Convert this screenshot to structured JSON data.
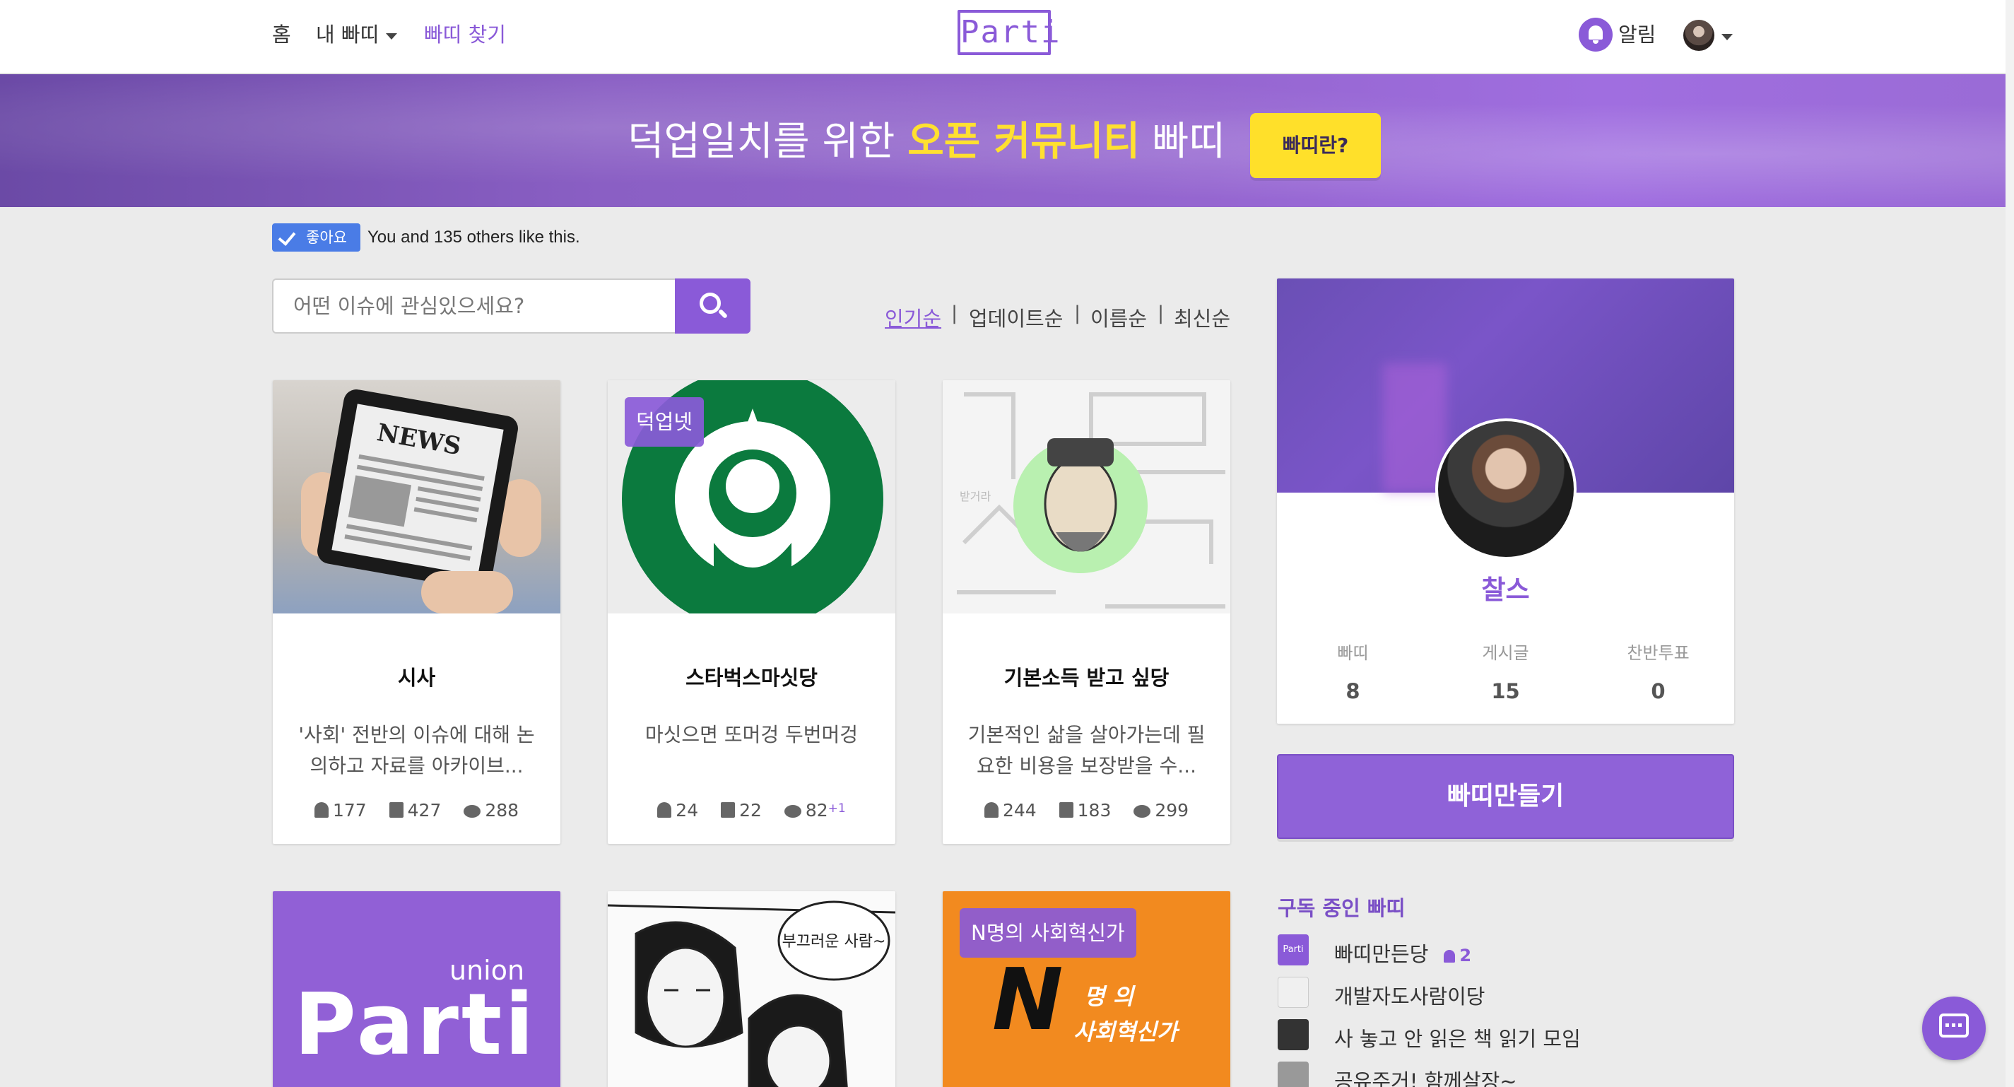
{
  "nav": {
    "home": "홈",
    "my_parti": "내 빠띠",
    "find_parti": "빠띠 찾기",
    "logo": "Parti",
    "alarm": "알림"
  },
  "banner": {
    "text_prefix": "덕업일치를 위한 ",
    "text_highlight": "오픈 커뮤니티",
    "text_suffix": " 빠띠",
    "button": "빠띠란?"
  },
  "like": {
    "button": "좋아요",
    "text": "You and 135 others like this."
  },
  "search": {
    "placeholder": "어떤 이슈에 관심있으세요?"
  },
  "sort": {
    "items": [
      "인기순",
      "업데이트순",
      "이름순",
      "최신순"
    ],
    "active": "인기순"
  },
  "cards": [
    {
      "title": "시사",
      "desc": "'사회' 전반의 이슈에 대해 논의하고 자료를 아카이브...",
      "members": "177",
      "posts": "427",
      "comments": "288",
      "image_text": "NEWS"
    },
    {
      "tag": "덕업넷",
      "title": "스타벅스마싯당",
      "desc": "마싯으면 또머겅 두번머겅",
      "members": "24",
      "posts": "22",
      "comments": "82",
      "new_comments": "+1"
    },
    {
      "title": "기본소득 받고 싶당",
      "desc": "기본적인 삶을 살아가는데 필요한 비용을 보장받을 수...",
      "members": "244",
      "posts": "183",
      "comments": "299",
      "image_text": "받거라"
    },
    {
      "image_text_top": "union",
      "image_text_main": "Parti"
    },
    {
      "image_text": "부끄러운 사람~"
    },
    {
      "tag": "N명의 사회혁신가",
      "image_text_line1": "명 의",
      "image_text_line2": "사회혁신가"
    }
  ],
  "profile": {
    "name": "찰스",
    "stats": [
      {
        "label": "빠띠",
        "value": "8"
      },
      {
        "label": "게시글",
        "value": "15"
      },
      {
        "label": "찬반투표",
        "value": "0"
      }
    ]
  },
  "make_button": "빠띠만들기",
  "subscriptions": {
    "title": "구독 중인 빠띠",
    "items": [
      {
        "name": "빠띠만든당",
        "count": "2",
        "thumb_text": "Parti"
      },
      {
        "name": "개발자도사람이당"
      },
      {
        "name": "사 놓고 안 읽은 책 읽기 모임"
      },
      {
        "name": "공유주거! 함께살장~"
      }
    ]
  },
  "colors": {
    "accent": "#8a5ad8",
    "banner_highlight": "#ffe030",
    "like_blue": "#4a7ce6",
    "card_orange": "#f28a1f"
  }
}
